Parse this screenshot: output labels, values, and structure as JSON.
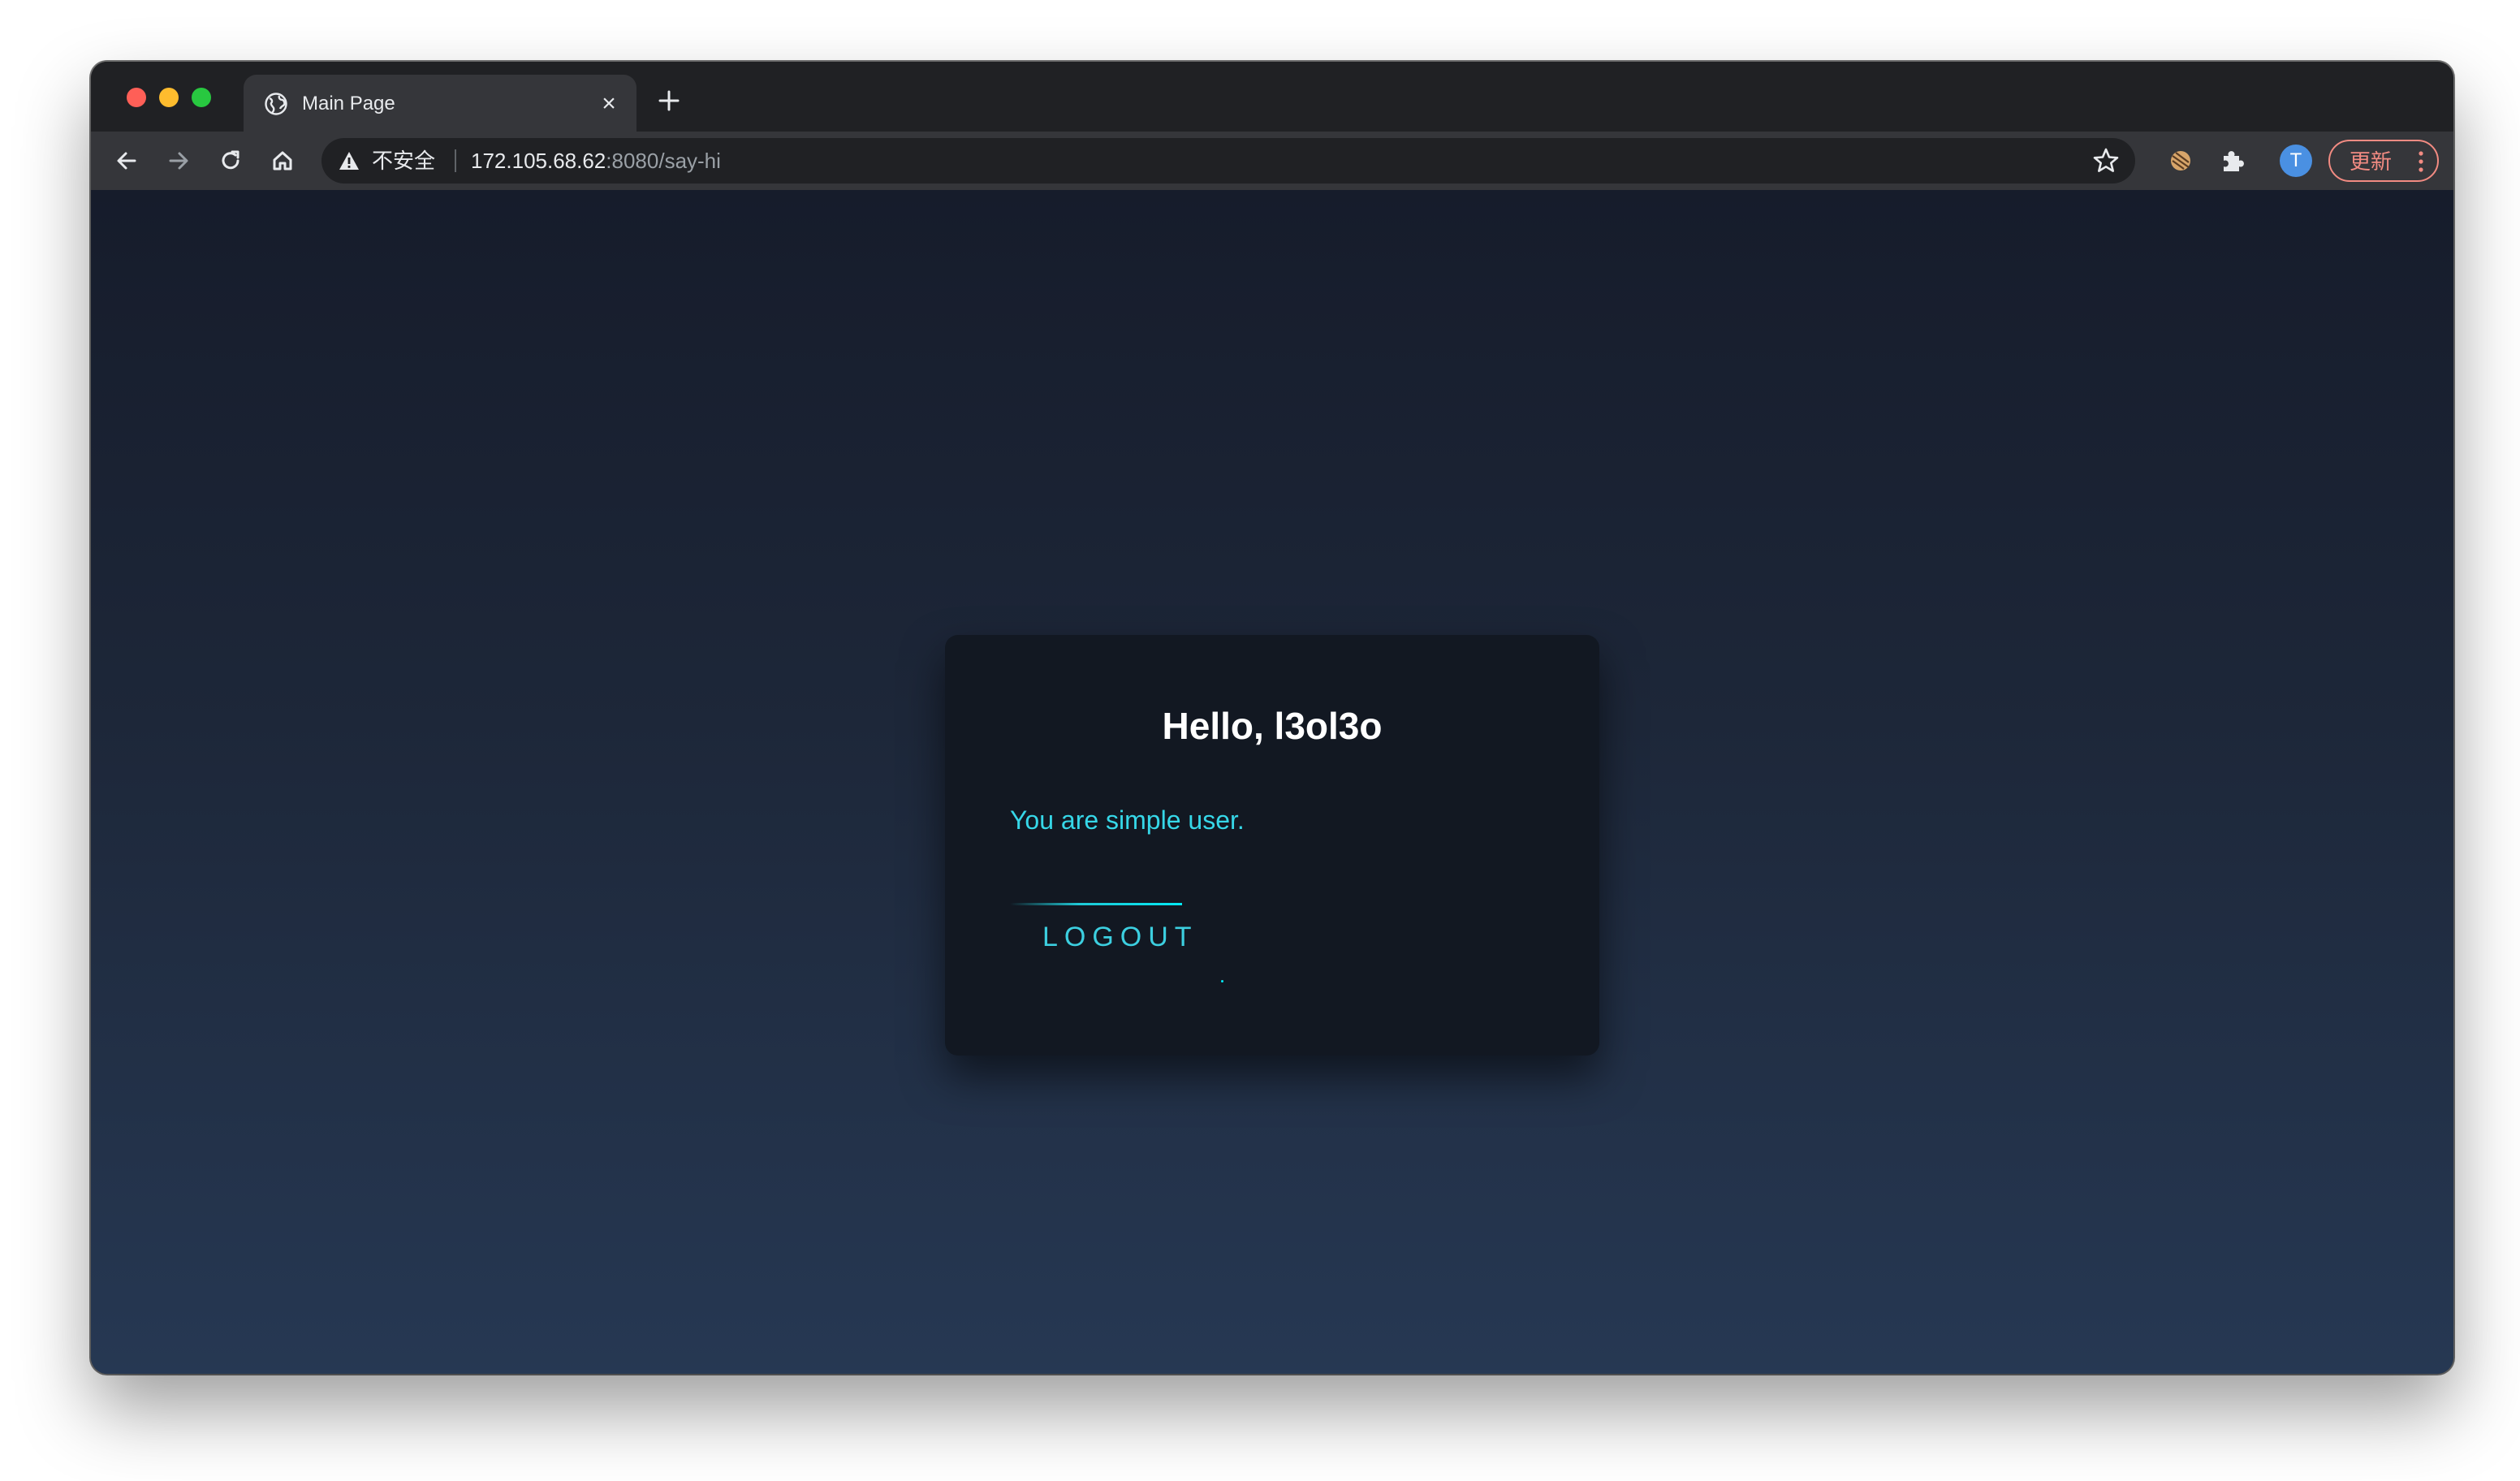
{
  "browser": {
    "tab": {
      "title": "Main Page",
      "close_glyph": "×",
      "icon": "globe-icon"
    },
    "toolbar": {
      "security_label": "不安全",
      "url_host": "172.105.68.62",
      "url_rest": ":8080/say-hi",
      "profile_initial": "T",
      "update_label": "更新"
    }
  },
  "page": {
    "title": "Hello, l3ol3o",
    "role_text": "You are simple user.",
    "logout_label": "LOGOUT"
  },
  "colors": {
    "accent": "#03e9f4",
    "card_bg": "#121822",
    "page_bg_top": "#161c2b",
    "page_bg_bottom": "#263853",
    "update_accent": "#f28b82",
    "avatar": "#4a90e2"
  }
}
